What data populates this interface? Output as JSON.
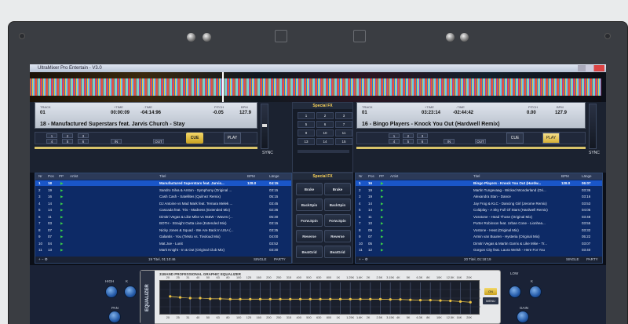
{
  "window": {
    "title": "UltraMixer Pro Entertain - V3.0"
  },
  "deckA": {
    "track_label": "TRACK",
    "track": "01",
    "time_label": "+TIME",
    "time": "00:00:09",
    "remain_label": "-TIME",
    "remain": "-04:14:96",
    "pitch_label": "PITCH",
    "pitch": "-0.05",
    "bpm_label": "BPM",
    "bpm": "127.9",
    "song": "18 - Manufactured Superstars feat. Jarvis Church - Stay",
    "cue": "CUE",
    "play": "PLAY",
    "sync": "SYNC",
    "loop": [
      "1",
      "2",
      "3",
      "4",
      "5",
      "6"
    ],
    "in": "IN",
    "out": "OUT"
  },
  "deckB": {
    "track_label": "TRACK",
    "track": "01",
    "time_label": "+TIME",
    "time": "03:23:14",
    "remain_label": "-TIME",
    "remain": "-02:44:42",
    "pitch_label": "PITCH",
    "pitch": "0.00",
    "bpm_label": "BPM",
    "bpm": "127.9",
    "song": "16 - Bingo Players - Knock You Out (Hardwell Remix)",
    "cue": "CUE",
    "play": "PLAY",
    "sync": "SYNC",
    "loop": [
      "1",
      "2",
      "3",
      "4",
      "5",
      "6"
    ],
    "in": "IN",
    "out": "OUT"
  },
  "specialfx": {
    "title": "Special FX",
    "pads": [
      "1",
      "2",
      "3",
      "4",
      "5",
      "6",
      "7",
      "8",
      "9",
      "10",
      "11",
      "12",
      "13",
      "14",
      "15",
      "16"
    ],
    "title2": "Special FX",
    "buttons": [
      "Brake",
      "Brake",
      "BackSpin",
      "BackSpin",
      "Forw.Spin",
      "Forw.Spin",
      "Reverse",
      "Reverse",
      "BeatGrid",
      "BeatGrid"
    ]
  },
  "playlistA": {
    "headers": {
      "nr": "Nr",
      "pos": "Pos",
      "pp": "PP",
      "artist": "Artist",
      "title": "Titel",
      "bpm": "BPM",
      "len": "Länge"
    },
    "rows": [
      {
        "nr": "1",
        "pos": "18",
        "title": "Manufactured Superstars feat. Jarvis...",
        "bpm": "128.0",
        "len": "04:15",
        "sel": true
      },
      {
        "nr": "2",
        "pos": "19",
        "title": "Sandro Silva & Arston - Symphony (Original ...",
        "bpm": "",
        "len": "03:15",
        "sel": false
      },
      {
        "nr": "3",
        "pos": "16",
        "title": "Cash Cash - Satellites (Quilnez Remix)",
        "bpm": "",
        "len": "05:15",
        "sel": false
      },
      {
        "nr": "4",
        "pos": "14",
        "title": "DJ Antoine vs Mad Mark feat. Temara Melek ...",
        "bpm": "",
        "len": "03:45",
        "sel": false
      },
      {
        "nr": "5",
        "pos": "14",
        "title": "Cascada feat. Tris - Madness (Extended Mix)",
        "bpm": "",
        "len": "02:36",
        "sel": false
      },
      {
        "nr": "6",
        "pos": "11",
        "title": "Dimitri Vegas & Like Mike vs W&W - Waves (...",
        "bpm": "",
        "len": "05:30",
        "sel": false
      },
      {
        "nr": "7",
        "pos": "03",
        "title": "BOTH - Straight Outta Line (Extended Mix)",
        "bpm": "",
        "len": "03:15",
        "sel": false
      },
      {
        "nr": "8",
        "pos": "07",
        "title": "Nicky Jones & Squad - We Are Back In USA (...",
        "bpm": "",
        "len": "03:35",
        "sel": false
      },
      {
        "nr": "9",
        "pos": "07",
        "title": "Galantis - You (Tiësto vs. Tivoloud Mix)",
        "bpm": "",
        "len": "04:00",
        "sel": false
      },
      {
        "nr": "10",
        "pos": "04",
        "title": "Mat.Joe - Lunit",
        "bpm": "",
        "len": "03:52",
        "sel": false
      },
      {
        "nr": "11",
        "pos": "13",
        "title": "Mark Knight - In & Out (Original Club Mix)",
        "bpm": "",
        "len": "03:30",
        "sel": false
      }
    ],
    "footer": "19 Titel, 01:10:46",
    "single": "SINGLE",
    "party": "PARTY"
  },
  "playlistB": {
    "headers": {
      "nr": "Nr",
      "pos": "Pos",
      "pp": "PP",
      "artist": "Artist",
      "title": "Titel",
      "bpm": "BPM",
      "len": "Länge"
    },
    "rows": [
      {
        "nr": "1",
        "pos": "16",
        "title": "Bingo Players - Knock You Out (Hardw...",
        "bpm": "128.0",
        "len": "06:07",
        "sel": true
      },
      {
        "nr": "2",
        "pos": "19",
        "title": "Martin Tungevaag - Wicked Wonderland (Ori...",
        "bpm": "",
        "len": "03:36",
        "sel": false
      },
      {
        "nr": "3",
        "pos": "19",
        "title": "Alexandra Stan - Dance",
        "bpm": "",
        "len": "03:16",
        "sel": false
      },
      {
        "nr": "4",
        "pos": "14",
        "title": "Jay Frog & KLC - Dancing Girl (Jerome Remix)",
        "bpm": "",
        "len": "03:53",
        "sel": false
      },
      {
        "nr": "5",
        "pos": "14",
        "title": "Coldplay - A Sky Full Of Stars (Hardwell Remix)",
        "bpm": "",
        "len": "04:05",
        "sel": false
      },
      {
        "nr": "6",
        "pos": "11",
        "title": "Vosstone - Head Those (Original Mix)",
        "bpm": "",
        "len": "03:48",
        "sel": false
      },
      {
        "nr": "7",
        "pos": "10",
        "title": "Porter Robinson feat. Urban Cone - Lionhea...",
        "bpm": "",
        "len": "03:55",
        "sel": false
      },
      {
        "nr": "8",
        "pos": "09",
        "title": "Vostone - Heat (Original Mix)",
        "bpm": "",
        "len": "03:32",
        "sel": false
      },
      {
        "nr": "9",
        "pos": "07",
        "title": "Armin van Buuren - Hysteria (Original Mix)",
        "bpm": "",
        "len": "05:22",
        "sel": false
      },
      {
        "nr": "10",
        "pos": "05",
        "title": "Dimitri Vegas & Martin Garrix & Like Mike - Tr...",
        "bpm": "",
        "len": "03:07",
        "sel": false
      },
      {
        "nr": "11",
        "pos": "12",
        "title": "Gorgon City feat. Laura Welsh - Here For You",
        "bpm": "",
        "len": "03:40",
        "sel": false
      }
    ],
    "footer": "20 Titel, 01:18:19",
    "single": "SINGLE",
    "party": "PARTY"
  },
  "equalizer": {
    "side": "EQUALIZER",
    "title": "31BAND PROFESSIONAL GRAPHIC EQUALIZER",
    "freqs": [
      "20",
      "25",
      "31",
      "40",
      "50",
      "63",
      "80",
      "100",
      "125",
      "160",
      "200",
      "250",
      "315",
      "400",
      "500",
      "630",
      "800",
      "1K",
      "1.25K",
      "1.6K",
      "2K",
      "2.5K",
      "3.15K",
      "4K",
      "5K",
      "6.3K",
      "8K",
      "10K",
      "12.5K",
      "16K",
      "20K"
    ],
    "levels": [
      0.55,
      0.52,
      0.5,
      0.5,
      0.48,
      0.48,
      0.47,
      0.47,
      0.47,
      0.47,
      0.47,
      0.47,
      0.47,
      0.47,
      0.47,
      0.47,
      0.47,
      0.47,
      0.47,
      0.47,
      0.47,
      0.47,
      0.46,
      0.46,
      0.45,
      0.44,
      0.44,
      0.43,
      0.42,
      0.4,
      0.38
    ],
    "on": "ON",
    "menu": "MENU"
  },
  "mixer": {
    "high": "HIGH",
    "hk": "K",
    "lk": "K",
    "pan": "PAN",
    "gain": "GAIN",
    "low": "LOW"
  }
}
